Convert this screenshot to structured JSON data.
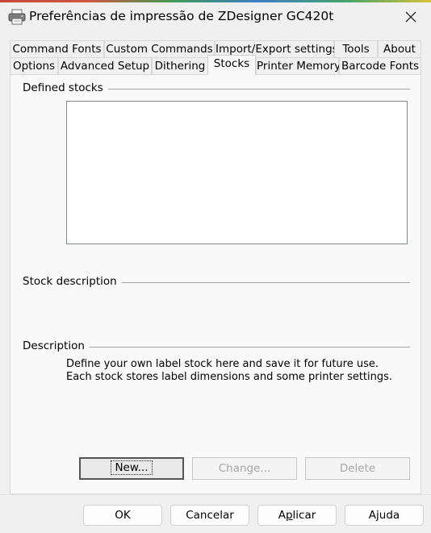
{
  "window": {
    "title": "Preferências de impressão de ZDesigner GC420t",
    "close_label": "Close"
  },
  "tabs_row1": [
    {
      "label": "Command Fonts"
    },
    {
      "label": "Custom Commands"
    },
    {
      "label": "Import/Export settings"
    },
    {
      "label": "Tools"
    },
    {
      "label": "About"
    }
  ],
  "tabs_row2": [
    {
      "label": "Options"
    },
    {
      "label": "Advanced Setup"
    },
    {
      "label": "Dithering"
    },
    {
      "label": "Stocks"
    },
    {
      "label": "Printer Memory"
    },
    {
      "label": "Barcode Fonts"
    }
  ],
  "active_tab": "Stocks",
  "stocks_panel": {
    "defined_stocks_label": "Defined stocks",
    "defined_stocks_items": [],
    "stock_description_label": "Stock description",
    "stock_description_value": "",
    "description_label": "Description",
    "description_text": "Define your own label stock here and save it for future use. Each stock stores label dimensions and some printer settings.",
    "new_button": "New...",
    "change_button": "Change...",
    "delete_button": "Delete"
  },
  "footer": {
    "ok": "OK",
    "cancel": "Cancelar",
    "apply_prefix": "A",
    "apply_ul": "p",
    "apply_suffix": "licar",
    "help": "Ajuda"
  },
  "icons": {
    "app": "printer-icon",
    "close": "close-icon"
  }
}
